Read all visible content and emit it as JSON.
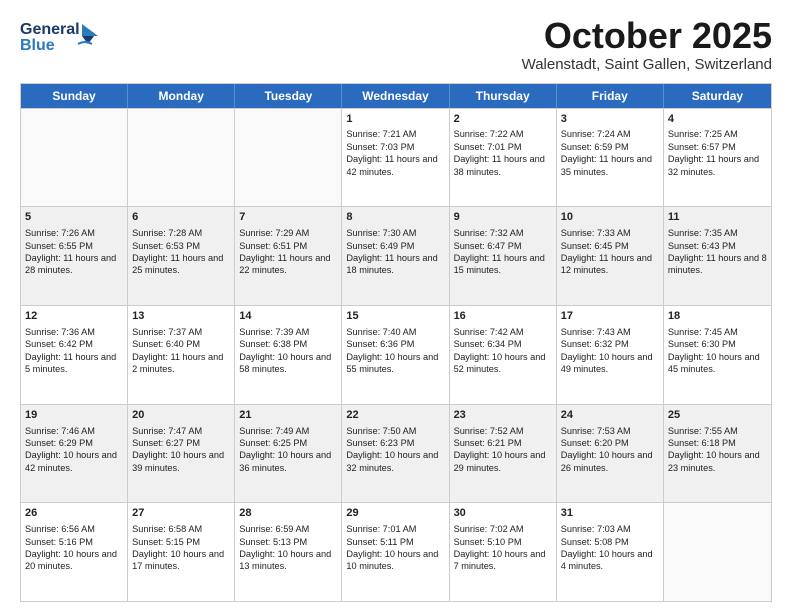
{
  "header": {
    "logo_line1": "General",
    "logo_line2": "Blue",
    "month": "October 2025",
    "location": "Walenstadt, Saint Gallen, Switzerland"
  },
  "days_of_week": [
    "Sunday",
    "Monday",
    "Tuesday",
    "Wednesday",
    "Thursday",
    "Friday",
    "Saturday"
  ],
  "rows": [
    [
      {
        "day": "",
        "content": ""
      },
      {
        "day": "",
        "content": ""
      },
      {
        "day": "",
        "content": ""
      },
      {
        "day": "1",
        "content": "Sunrise: 7:21 AM\nSunset: 7:03 PM\nDaylight: 11 hours and 42 minutes."
      },
      {
        "day": "2",
        "content": "Sunrise: 7:22 AM\nSunset: 7:01 PM\nDaylight: 11 hours and 38 minutes."
      },
      {
        "day": "3",
        "content": "Sunrise: 7:24 AM\nSunset: 6:59 PM\nDaylight: 11 hours and 35 minutes."
      },
      {
        "day": "4",
        "content": "Sunrise: 7:25 AM\nSunset: 6:57 PM\nDaylight: 11 hours and 32 minutes."
      }
    ],
    [
      {
        "day": "5",
        "content": "Sunrise: 7:26 AM\nSunset: 6:55 PM\nDaylight: 11 hours and 28 minutes."
      },
      {
        "day": "6",
        "content": "Sunrise: 7:28 AM\nSunset: 6:53 PM\nDaylight: 11 hours and 25 minutes."
      },
      {
        "day": "7",
        "content": "Sunrise: 7:29 AM\nSunset: 6:51 PM\nDaylight: 11 hours and 22 minutes."
      },
      {
        "day": "8",
        "content": "Sunrise: 7:30 AM\nSunset: 6:49 PM\nDaylight: 11 hours and 18 minutes."
      },
      {
        "day": "9",
        "content": "Sunrise: 7:32 AM\nSunset: 6:47 PM\nDaylight: 11 hours and 15 minutes."
      },
      {
        "day": "10",
        "content": "Sunrise: 7:33 AM\nSunset: 6:45 PM\nDaylight: 11 hours and 12 minutes."
      },
      {
        "day": "11",
        "content": "Sunrise: 7:35 AM\nSunset: 6:43 PM\nDaylight: 11 hours and 8 minutes."
      }
    ],
    [
      {
        "day": "12",
        "content": "Sunrise: 7:36 AM\nSunset: 6:42 PM\nDaylight: 11 hours and 5 minutes."
      },
      {
        "day": "13",
        "content": "Sunrise: 7:37 AM\nSunset: 6:40 PM\nDaylight: 11 hours and 2 minutes."
      },
      {
        "day": "14",
        "content": "Sunrise: 7:39 AM\nSunset: 6:38 PM\nDaylight: 10 hours and 58 minutes."
      },
      {
        "day": "15",
        "content": "Sunrise: 7:40 AM\nSunset: 6:36 PM\nDaylight: 10 hours and 55 minutes."
      },
      {
        "day": "16",
        "content": "Sunrise: 7:42 AM\nSunset: 6:34 PM\nDaylight: 10 hours and 52 minutes."
      },
      {
        "day": "17",
        "content": "Sunrise: 7:43 AM\nSunset: 6:32 PM\nDaylight: 10 hours and 49 minutes."
      },
      {
        "day": "18",
        "content": "Sunrise: 7:45 AM\nSunset: 6:30 PM\nDaylight: 10 hours and 45 minutes."
      }
    ],
    [
      {
        "day": "19",
        "content": "Sunrise: 7:46 AM\nSunset: 6:29 PM\nDaylight: 10 hours and 42 minutes."
      },
      {
        "day": "20",
        "content": "Sunrise: 7:47 AM\nSunset: 6:27 PM\nDaylight: 10 hours and 39 minutes."
      },
      {
        "day": "21",
        "content": "Sunrise: 7:49 AM\nSunset: 6:25 PM\nDaylight: 10 hours and 36 minutes."
      },
      {
        "day": "22",
        "content": "Sunrise: 7:50 AM\nSunset: 6:23 PM\nDaylight: 10 hours and 32 minutes."
      },
      {
        "day": "23",
        "content": "Sunrise: 7:52 AM\nSunset: 6:21 PM\nDaylight: 10 hours and 29 minutes."
      },
      {
        "day": "24",
        "content": "Sunrise: 7:53 AM\nSunset: 6:20 PM\nDaylight: 10 hours and 26 minutes."
      },
      {
        "day": "25",
        "content": "Sunrise: 7:55 AM\nSunset: 6:18 PM\nDaylight: 10 hours and 23 minutes."
      }
    ],
    [
      {
        "day": "26",
        "content": "Sunrise: 6:56 AM\nSunset: 5:16 PM\nDaylight: 10 hours and 20 minutes."
      },
      {
        "day": "27",
        "content": "Sunrise: 6:58 AM\nSunset: 5:15 PM\nDaylight: 10 hours and 17 minutes."
      },
      {
        "day": "28",
        "content": "Sunrise: 6:59 AM\nSunset: 5:13 PM\nDaylight: 10 hours and 13 minutes."
      },
      {
        "day": "29",
        "content": "Sunrise: 7:01 AM\nSunset: 5:11 PM\nDaylight: 10 hours and 10 minutes."
      },
      {
        "day": "30",
        "content": "Sunrise: 7:02 AM\nSunset: 5:10 PM\nDaylight: 10 hours and 7 minutes."
      },
      {
        "day": "31",
        "content": "Sunrise: 7:03 AM\nSunset: 5:08 PM\nDaylight: 10 hours and 4 minutes."
      },
      {
        "day": "",
        "content": ""
      }
    ]
  ]
}
